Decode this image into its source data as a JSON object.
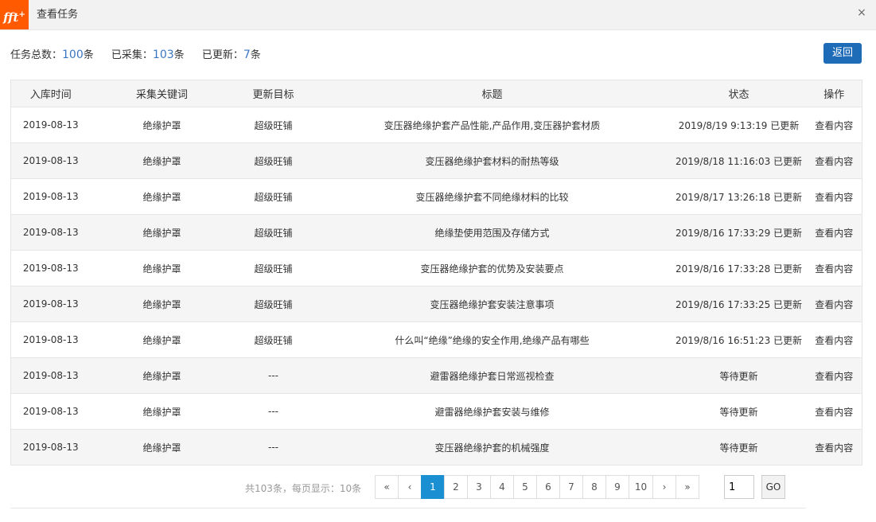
{
  "window": {
    "logo_text": "fft",
    "logo_sup": "+",
    "title": "查看任务",
    "close_symbol": "×"
  },
  "stats": {
    "total_label": "任务总数：",
    "total_value": "100",
    "total_unit": "条",
    "collected_label": "已采集：",
    "collected_value": "103",
    "collected_unit": "条",
    "updated_label": "已更新：",
    "updated_value": "7",
    "updated_unit": "条"
  },
  "back_button": "返回",
  "table": {
    "headers": [
      "入库时间",
      "采集关键词",
      "更新目标",
      "标题",
      "状态",
      "操作"
    ],
    "rows": [
      {
        "date": "2019-08-13",
        "keyword": "绝缘护罩",
        "target": "超级旺铺",
        "title": "变压器绝缘护套产品性能,产品作用,变压器护套材质",
        "status": "2019/8/19 9:13:19 已更新",
        "action": "查看内容"
      },
      {
        "date": "2019-08-13",
        "keyword": "绝缘护罩",
        "target": "超级旺铺",
        "title": "变压器绝缘护套材料的耐热等级",
        "status": "2019/8/18 11:16:03 已更新",
        "action": "查看内容"
      },
      {
        "date": "2019-08-13",
        "keyword": "绝缘护罩",
        "target": "超级旺铺",
        "title": "变压器绝缘护套不同绝缘材料的比较",
        "status": "2019/8/17 13:26:18 已更新",
        "action": "查看内容"
      },
      {
        "date": "2019-08-13",
        "keyword": "绝缘护罩",
        "target": "超级旺铺",
        "title": "绝缘垫使用范围及存储方式",
        "status": "2019/8/16 17:33:29 已更新",
        "action": "查看内容"
      },
      {
        "date": "2019-08-13",
        "keyword": "绝缘护罩",
        "target": "超级旺铺",
        "title": "变压器绝缘护套的优势及安装要点",
        "status": "2019/8/16 17:33:28 已更新",
        "action": "查看内容"
      },
      {
        "date": "2019-08-13",
        "keyword": "绝缘护罩",
        "target": "超级旺铺",
        "title": "变压器绝缘护套安装注意事项",
        "status": "2019/8/16 17:33:25 已更新",
        "action": "查看内容"
      },
      {
        "date": "2019-08-13",
        "keyword": "绝缘护罩",
        "target": "超级旺铺",
        "title": "什么叫“绝缘”绝缘的安全作用,绝缘产品有哪些",
        "status": "2019/8/16 16:51:23 已更新",
        "action": "查看内容"
      },
      {
        "date": "2019-08-13",
        "keyword": "绝缘护罩",
        "target": "---",
        "title": "避雷器绝缘护套日常巡视检查",
        "status": "等待更新",
        "action": "查看内容"
      },
      {
        "date": "2019-08-13",
        "keyword": "绝缘护罩",
        "target": "---",
        "title": "避雷器绝缘护套安装与维修",
        "status": "等待更新",
        "action": "查看内容"
      },
      {
        "date": "2019-08-13",
        "keyword": "绝缘护罩",
        "target": "---",
        "title": "变压器绝缘护套的机械强度",
        "status": "等待更新",
        "action": "查看内容"
      }
    ]
  },
  "pagination": {
    "info": "共103条，每页显示：10条",
    "first": "«",
    "prev": "‹",
    "pages": [
      "1",
      "2",
      "3",
      "4",
      "5",
      "6",
      "7",
      "8",
      "9",
      "10"
    ],
    "current_page": "1",
    "next": "›",
    "last": "»",
    "jump_value": "1",
    "go_label": "GO"
  },
  "colors": {
    "accent": "#1e6bb8",
    "link": "#2b66b3",
    "updated": "#1e8a1e",
    "waiting": "#e0601b",
    "page_active": "#1a90d2",
    "logo_bg": "#ff5a00"
  }
}
